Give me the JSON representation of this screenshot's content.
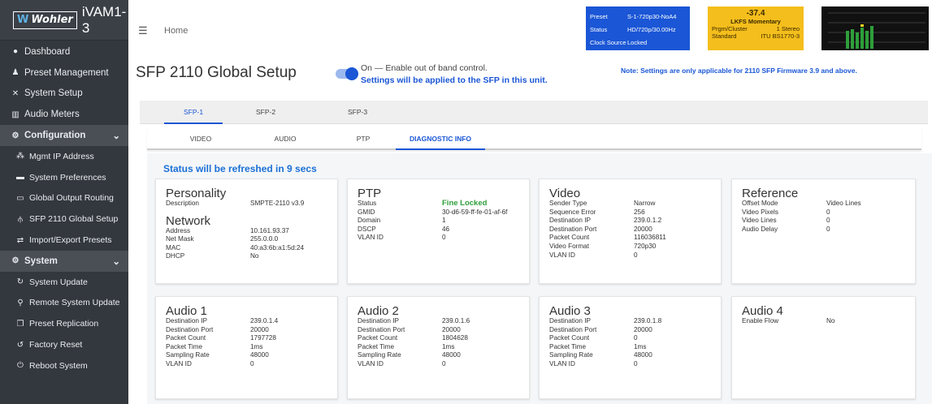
{
  "brand": {
    "logo": "Wohler",
    "model": "iVAM1-3"
  },
  "nav": {
    "dashboard": "Dashboard",
    "preset_management": "Preset Management",
    "system_setup": "System Setup",
    "audio_meters": "Audio Meters",
    "configuration": "Configuration",
    "mgmt_ip": "Mgmt IP Address",
    "system_preferences": "System Preferences",
    "global_output_routing": "Global Output Routing",
    "sfp_2110": "SFP 2110 Global Setup",
    "import_export": "Import/Export Presets",
    "system": "System",
    "system_update": "System Update",
    "remote_update": "Remote System Update",
    "preset_replication": "Preset Replication",
    "factory_reset": "Factory Reset",
    "reboot": "Reboot System"
  },
  "header": {
    "breadcrumb": "Home",
    "preset": {
      "preset_k": "Preset",
      "preset_v": "S-1-720p30-NoA4",
      "status_k": "Status",
      "status_v": "HD/720p/30.00Hz",
      "clock_k": "Clock Source",
      "clock_v": "Locked"
    },
    "lkfs": {
      "value": "-37.4",
      "label": "LKFS  Momentary",
      "prgm_k": "Prgm/Cluster",
      "prgm_v": "1  Stereo",
      "std_k": "Standard",
      "std_v": "ITU BS1770-3"
    }
  },
  "page": {
    "title": "SFP 2110 Global Setup",
    "toggle_label": "On — Enable out of band control.",
    "toggle_note": "Settings will be applied to the SFP in this unit.",
    "fw_note": "Note: Settings are only applicable for 2110 SFP Firmware 3.9 and above.",
    "refresh": "Status will be refreshed in 9 secs"
  },
  "sfp_tabs": [
    "SFP-1",
    "SFP-2",
    "SFP-3"
  ],
  "sub_tabs": [
    "VIDEO",
    "AUDIO",
    "PTP",
    "DIAGNOSTIC INFO"
  ],
  "cards": {
    "personality": {
      "title": "Personality",
      "rows": [
        {
          "k": "Description",
          "v": "SMPTE-2110 v3.9"
        }
      ],
      "title2": "Network",
      "rows2": [
        {
          "k": "Address",
          "v": "10.161.93.37"
        },
        {
          "k": "Net Mask",
          "v": "255.0.0.0"
        },
        {
          "k": "MAC",
          "v": "40:a3:6b:a1:5d:24"
        },
        {
          "k": "DHCP",
          "v": "No"
        }
      ]
    },
    "ptp": {
      "title": "PTP",
      "rows": [
        {
          "k": "Status",
          "v": "Fine Locked"
        },
        {
          "k": "GMID",
          "v": "30-d6-59-ff-fe-01-af-6f"
        },
        {
          "k": "Domain",
          "v": "1"
        },
        {
          "k": "DSCP",
          "v": "46"
        },
        {
          "k": "VLAN ID",
          "v": "0"
        }
      ]
    },
    "video": {
      "title": "Video",
      "rows": [
        {
          "k": "Sender Type",
          "v": "Narrow"
        },
        {
          "k": "Sequence Error",
          "v": "256"
        },
        {
          "k": "Destination IP",
          "v": "239.0.1.2"
        },
        {
          "k": "Destination Port",
          "v": "20000"
        },
        {
          "k": "Packet Count",
          "v": "116036811"
        },
        {
          "k": "Video Format",
          "v": "720p30"
        },
        {
          "k": "VLAN ID",
          "v": "0"
        }
      ]
    },
    "reference": {
      "title": "Reference",
      "rows": [
        {
          "k": "Offset Mode",
          "v": "Video Lines"
        },
        {
          "k": "Video Pixels",
          "v": "0"
        },
        {
          "k": "Video Lines",
          "v": "0"
        },
        {
          "k": "Audio Delay",
          "v": "0"
        }
      ]
    },
    "audio1": {
      "title": "Audio 1",
      "rows": [
        {
          "k": "Destination IP",
          "v": "239.0.1.4"
        },
        {
          "k": "Destination Port",
          "v": "20000"
        },
        {
          "k": "Packet Count",
          "v": "1797728"
        },
        {
          "k": "Packet Time",
          "v": "1ms"
        },
        {
          "k": "Sampling Rate",
          "v": "48000"
        },
        {
          "k": "VLAN ID",
          "v": "0"
        }
      ]
    },
    "audio2": {
      "title": "Audio 2",
      "rows": [
        {
          "k": "Destination IP",
          "v": "239.0.1.6"
        },
        {
          "k": "Destination Port",
          "v": "20000"
        },
        {
          "k": "Packet Count",
          "v": "1804628"
        },
        {
          "k": "Packet Time",
          "v": "1ms"
        },
        {
          "k": "Sampling Rate",
          "v": "48000"
        },
        {
          "k": "VLAN ID",
          "v": "0"
        }
      ]
    },
    "audio3": {
      "title": "Audio 3",
      "rows": [
        {
          "k": "Destination IP",
          "v": "239.0.1.8"
        },
        {
          "k": "Destination Port",
          "v": "20000"
        },
        {
          "k": "Packet Count",
          "v": "0"
        },
        {
          "k": "Packet Time",
          "v": "1ms"
        },
        {
          "k": "Sampling Rate",
          "v": "48000"
        },
        {
          "k": "VLAN ID",
          "v": "0"
        }
      ]
    },
    "audio4": {
      "title": "Audio 4",
      "rows": [
        {
          "k": "Enable Flow",
          "v": "No"
        }
      ]
    }
  },
  "colors": {
    "accent": "#1a56d6",
    "sidebar": "#33383e",
    "locked": "#2e9e3a",
    "lkfs_bg": "#f4be1c"
  }
}
